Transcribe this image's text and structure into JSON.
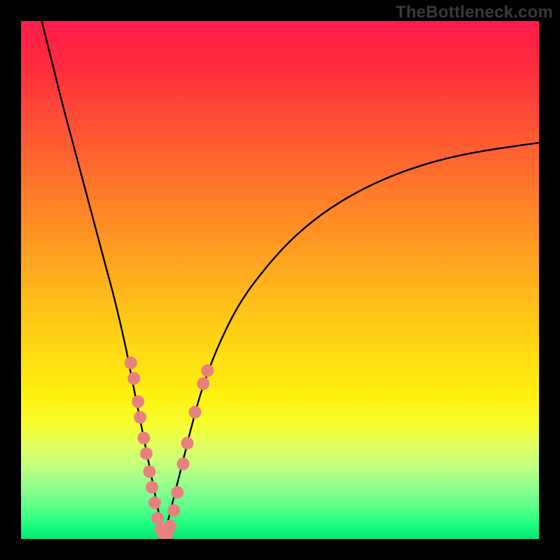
{
  "watermark": "TheBottleneck.com",
  "colors": {
    "frame": "#000000",
    "curve": "#000000",
    "dot": "#e98080",
    "gradient_top": "#ff1a4b",
    "gradient_bottom": "#00e676"
  },
  "chart_data": {
    "type": "line",
    "title": "",
    "xlabel": "",
    "ylabel": "",
    "xlim": [
      0,
      100
    ],
    "ylim": [
      0,
      100
    ],
    "series": [
      {
        "name": "left-branch",
        "x": [
          4,
          6,
          8,
          10,
          12,
          14,
          16,
          18,
          20,
          21,
          22,
          23,
          24,
          25,
          26,
          27,
          27.5
        ],
        "y": [
          100,
          92,
          84,
          76.5,
          69,
          61.5,
          54,
          46.5,
          38,
          33,
          28,
          23,
          18,
          13,
          8,
          3,
          0.5
        ]
      },
      {
        "name": "right-branch",
        "x": [
          27.5,
          28,
          29,
          30,
          31.5,
          33,
          35,
          38,
          42,
          47,
          53,
          60,
          68,
          77,
          87,
          100
        ],
        "y": [
          0.5,
          2,
          6,
          10,
          16,
          22,
          29,
          37,
          45,
          52,
          58.5,
          64,
          68.5,
          72,
          74.5,
          76.5
        ]
      }
    ],
    "points": [
      {
        "name": "p1",
        "x": 21.2,
        "y": 34.0
      },
      {
        "name": "p2",
        "x": 21.8,
        "y": 31.0
      },
      {
        "name": "p3",
        "x": 22.6,
        "y": 26.5
      },
      {
        "name": "p4",
        "x": 23.0,
        "y": 23.5
      },
      {
        "name": "p5",
        "x": 23.7,
        "y": 19.5
      },
      {
        "name": "p6",
        "x": 24.2,
        "y": 16.5
      },
      {
        "name": "p7",
        "x": 24.8,
        "y": 13.0
      },
      {
        "name": "p8",
        "x": 25.3,
        "y": 10.0
      },
      {
        "name": "p9",
        "x": 25.8,
        "y": 7.0
      },
      {
        "name": "p10",
        "x": 26.4,
        "y": 4.0
      },
      {
        "name": "p11",
        "x": 27.0,
        "y": 1.8
      },
      {
        "name": "p12",
        "x": 27.6,
        "y": 0.8
      },
      {
        "name": "p13",
        "x": 28.2,
        "y": 1.0
      },
      {
        "name": "p14",
        "x": 28.8,
        "y": 2.5
      },
      {
        "name": "p15",
        "x": 29.5,
        "y": 5.5
      },
      {
        "name": "p16",
        "x": 30.2,
        "y": 9.0
      },
      {
        "name": "p17",
        "x": 31.3,
        "y": 14.5
      },
      {
        "name": "p18",
        "x": 32.1,
        "y": 18.5
      },
      {
        "name": "p19",
        "x": 33.6,
        "y": 24.5
      },
      {
        "name": "p20",
        "x": 35.2,
        "y": 30.0
      },
      {
        "name": "p21",
        "x": 36.0,
        "y": 32.5
      }
    ],
    "notes": "V-shaped bottleneck curve on a vertical rainbow heat gradient. x/y are in percent of plot area; y=0 is bottom (green), y=100 is top (red). No numeric axes or tick labels are shown in the source image; values are geometric estimates."
  }
}
